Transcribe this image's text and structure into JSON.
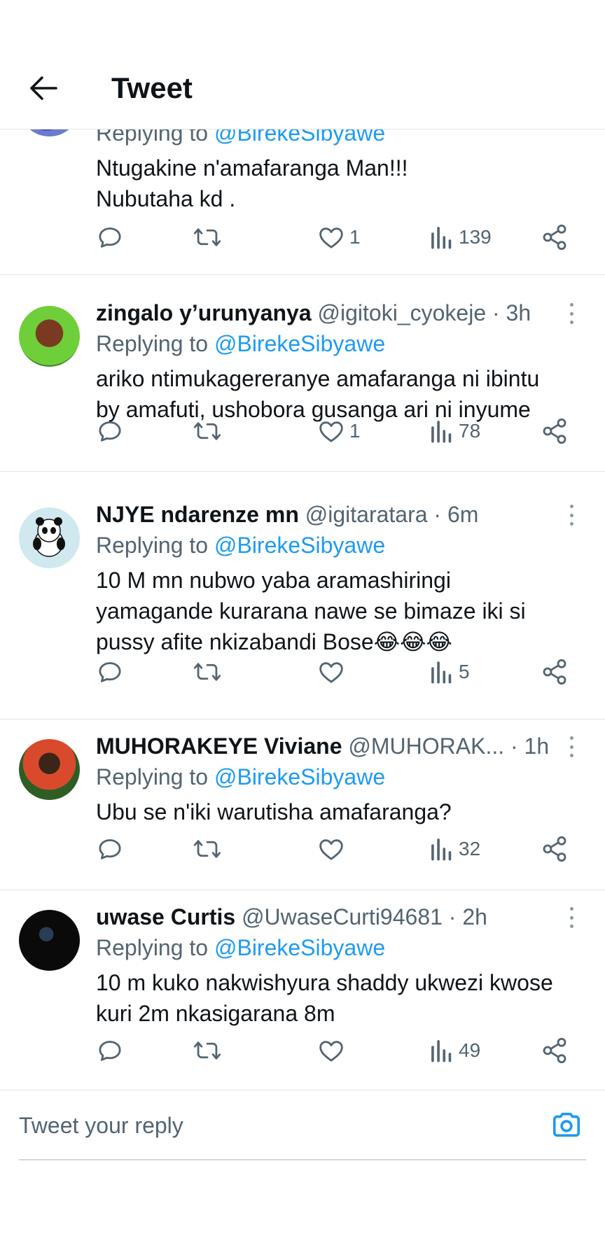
{
  "header": {
    "title": "Tweet"
  },
  "tweets": [
    {
      "display_name": "",
      "handle": "",
      "replying_prefix": "Replying to",
      "replying_to": "@BirekeSibyawe",
      "text": "Ntugakine n'amafaranga Man!!!\nNubutaha kd .",
      "likes": "1",
      "views": "139"
    },
    {
      "display_name": "zingalo y’urunyanya",
      "handle": "@igitoki_cyokeje · 3h",
      "replying_prefix": "Replying to",
      "replying_to": "@BirekeSibyawe",
      "text": "ariko ntimukagereranye amafaranga ni ibintu\nby amafuti, ushobora gusanga ari ni inyume",
      "likes": "1",
      "views": "78"
    },
    {
      "display_name": "NJYE ndarenze mn",
      "handle": "@igitaratara · 6m",
      "replying_prefix": "Replying to",
      "replying_to": "@BirekeSibyawe",
      "text": "10 M mn nubwo yaba aramashiringi\nyamagande  kurarana nawe se bimaze iki si\npussy afite nkizabandi Bose😂😂😂",
      "likes": "",
      "views": "5"
    },
    {
      "display_name": "MUHORAKEYE Viviane",
      "handle": "@MUHORAK... · 1h",
      "replying_prefix": "Replying to",
      "replying_to": "@BirekeSibyawe",
      "text": "Ubu se n'iki warutisha amafaranga?",
      "likes": "",
      "views": "32"
    },
    {
      "display_name": "uwase Curtis",
      "handle": "@UwaseCurti94681 · 2h",
      "replying_prefix": "Replying to",
      "replying_to": "@BirekeSibyawe",
      "text": "10 m kuko nakwishyura shaddy ukwezi kwose\nkuri 2m nkasigarana 8m",
      "likes": "",
      "views": "49"
    }
  ],
  "reply_box": {
    "placeholder": "Tweet your reply"
  },
  "colors": {
    "accent": "#1d9bf0",
    "muted": "#536471",
    "text": "#0f1419",
    "divider": "#e1e4e6"
  },
  "icons": [
    "back-arrow-icon",
    "reply-icon",
    "retweet-icon",
    "heart-icon",
    "views-icon",
    "share-icon",
    "more-icon",
    "camera-icon"
  ]
}
